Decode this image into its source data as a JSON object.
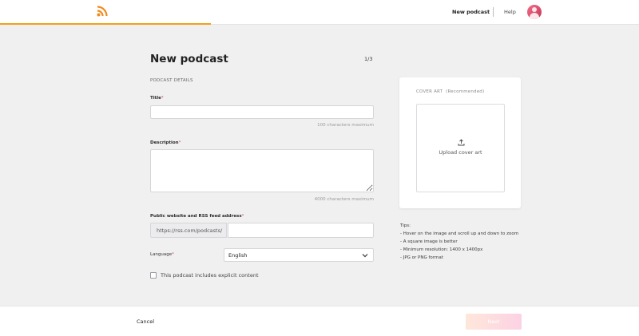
{
  "header": {
    "nav_new_podcast": "New podcast",
    "nav_help": "Help",
    "accent_color": "#f4a018",
    "progress_fraction": 0.33
  },
  "form": {
    "title": "New podcast",
    "step": "1/3",
    "section_label": "PODCAST DETAILS",
    "title_field": {
      "label": "Title",
      "required_mark": "*",
      "value": "",
      "hint": "100 characters maximum"
    },
    "description_field": {
      "label": "Description",
      "required_mark": "*",
      "value": "",
      "hint": "4000 characters maximum"
    },
    "url_field": {
      "label": "Public website and RSS feed address",
      "required_mark": "*",
      "prefix": "https://rss.com/podcasts/",
      "value": ""
    },
    "language_field": {
      "label": "Language",
      "required_mark": "*",
      "selected": "English"
    },
    "explicit": {
      "label": "This podcast includes explicit content",
      "checked": false
    }
  },
  "cover": {
    "title": "COVER ART",
    "note": "(Recommended)",
    "upload_text": "Upload cover art",
    "upload_icon": "upload-icon"
  },
  "tips": {
    "heading": "Tips:",
    "items": [
      "- Hover on the image and scroll up and down to zoom",
      "- A square image is better",
      "- Minimum resolution: 1400 x 1400px",
      "- JPG or PNG format"
    ]
  },
  "footer": {
    "cancel": "Cancel",
    "next": "Next"
  }
}
